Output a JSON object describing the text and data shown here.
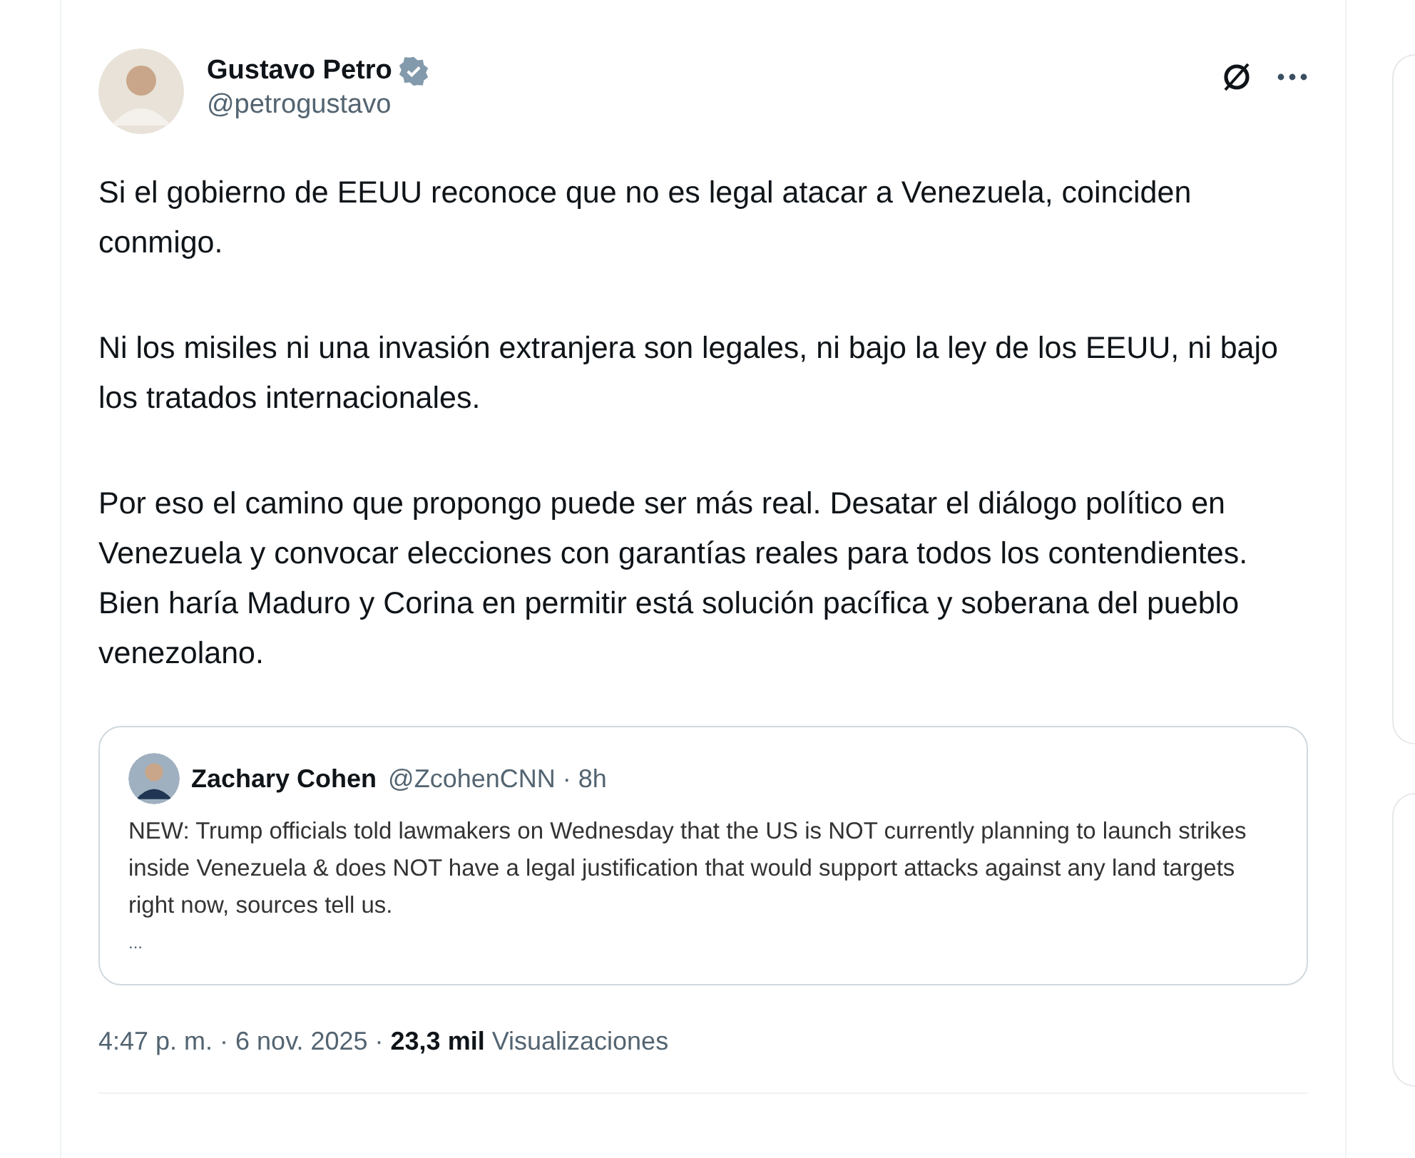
{
  "author": {
    "name": "Gustavo Petro",
    "handle": "@petrogustavo",
    "verified": true
  },
  "paragraphs": [
    "Si el gobierno de EEUU reconoce que no es legal atacar a Venezuela, coinciden conmigo.",
    "Ni los misiles ni una invasión extranjera son legales, ni bajo la ley de los EEUU, ni bajo los tratados internacionales.",
    "Por eso el camino que propongo puede ser más real. Desatar el diálogo político en Venezuela y convocar elecciones con garantías reales para todos los contendientes. Bien haría Maduro y Corina en permitir está solución pacífica y soberana del pueblo venezolano."
  ],
  "quote": {
    "name": "Zachary Cohen",
    "handle_time": "@ZcohenCNN · 8h",
    "text": "NEW: Trump officials told lawmakers on Wednesday that the US is NOT currently planning to launch strikes inside Venezuela & does NOT have a legal justification that would support attacks against any land targets right now, sources tell us.",
    "more": "..."
  },
  "meta": "4:47 p. m. · 6 nov. 2025 · **23,3 mil** Visualizaciones"
}
